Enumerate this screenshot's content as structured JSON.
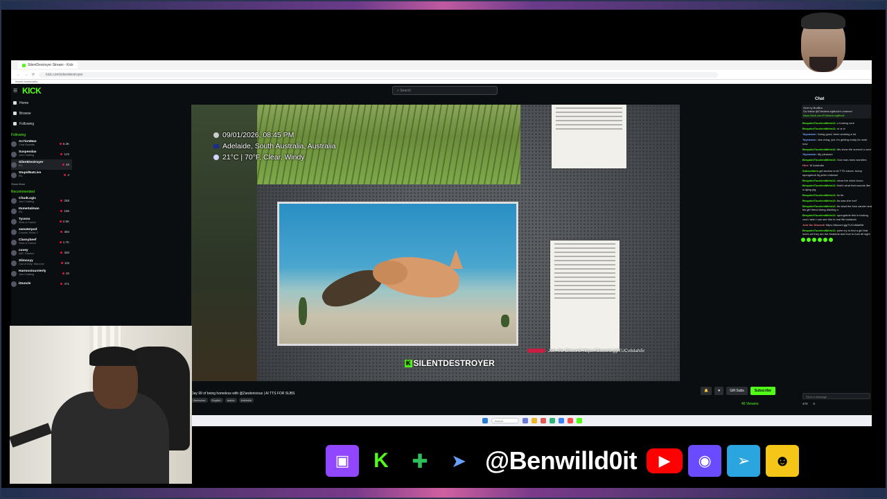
{
  "browser": {
    "tab_title": "SilentDestroyer Stream - Kick",
    "url": "kick.com/silentdestroyer",
    "bookmarks": "Import bookmarks..."
  },
  "kick": {
    "logo": "KICK",
    "search_placeholder": "Search",
    "nav": [
      "Home",
      "Browse",
      "Following"
    ],
    "following_title": "Following",
    "following": [
      {
        "name": "Ac7ionMan",
        "cat": "Chat Roulette",
        "viewers": "6.3K"
      },
      {
        "name": "Suspendas",
        "cat": "Just Chatting",
        "viewers": "123"
      },
      {
        "name": "SilentDestroyer",
        "cat": "IRL",
        "viewers": "46"
      },
      {
        "name": "StupidNatLive",
        "cat": "IRL",
        "viewers": "4"
      }
    ],
    "show_more": "Show More",
    "recommended_title": "Recommended",
    "recommended": [
      {
        "name": "ChudLogic",
        "cat": "Just Chatting",
        "viewers": "258"
      },
      {
        "name": "ItsmeSalman",
        "cat": "IRL",
        "viewers": "196"
      },
      {
        "name": "Tyceno",
        "cat": "Slots & Casino",
        "viewers": "2.5K"
      },
      {
        "name": "sweaterpxd",
        "cat": "Counter-Strike 2",
        "viewers": "383"
      },
      {
        "name": "Classybeef",
        "cat": "Slots & Casino",
        "viewers": "1.7K"
      },
      {
        "name": "cuvey",
        "cat": "ARC Raiders",
        "viewers": "300"
      },
      {
        "name": "Slimssyy",
        "cat": "Call of Duty: Warzone",
        "viewers": "115"
      },
      {
        "name": "HarmoniousVerly",
        "cat": "Just Chatting",
        "viewers": "20"
      },
      {
        "name": "iDuncle",
        "cat": "",
        "viewers": "471"
      }
    ]
  },
  "stream": {
    "overlay_datetime": "09/01/2026, 08:45 PM",
    "overlay_location": "Adelaide, South Australia, Australia",
    "overlay_weather": "21°C | 70°F, Clear, Windy",
    "brand_k": "K",
    "brand_name": "SILENTDESTROYER",
    "discord_text": "Join the Discord! https://discord.gg/TUCv8daN5r",
    "title": "Day 99 of being homeless with @Zandericious | AI TTS FOR SUBS",
    "tags": [
      "Awesome",
      "English",
      "arabic",
      "Adelaide"
    ],
    "gift_subs": "Gift Subs",
    "subscribe": "Subscribe",
    "viewers": "46 Viewers"
  },
  "chat": {
    "title": "Chat",
    "pinned_user": "Sent by BudBro",
    "pinned_text": "Go follow @ChickenLegModz's channel",
    "pinned_link": "https://kick.com/ChickenLegModz",
    "messages": [
      {
        "user": "BespokeTouchesMeIm12:",
        "text": "u fucking cunt"
      },
      {
        "user": "BespokeTouchesMeIm12:",
        "text": "oi oi oi"
      },
      {
        "user": "Taysmann:",
        "text": "Doing good, been working a lot"
      },
      {
        "user": "BespokeTouchesMeIm12:",
        "text": "",
        "kind": "plain"
      },
      {
        "user": "Taysmann:",
        "text": "cha ching, yes I'm getting ready for work now"
      },
      {
        "user": "BespokeTouchesMeIm12:",
        "text": "fits show the sunroof u cunt"
      },
      {
        "user": "Taysmann:",
        "text": "My pleasure"
      },
      {
        "user": "BespokeTouchesMeIm12:",
        "text": "God man does wonders"
      },
      {
        "user": "Hiro:",
        "text": "W Australia"
      },
      {
        "user": "Subscribers",
        "text": "get access to AI TTS voices: trump spongebob lbj peter mrbeast"
      },
      {
        "user": "BespokeTouchesMeIm12:",
        "text": "show the chick brooo"
      },
      {
        "user": "BespokeTouchesMeIm12:",
        "text": "that's what that sounds like a dying pig"
      },
      {
        "user": "BespokeTouchesMeIm12:",
        "text": "fix tts"
      },
      {
        "user": "BespokeTouchesMeIm12:",
        "text": "tts was she hot?"
      },
      {
        "user": "BespokeTouchesMeIm12:",
        "text": "tts what the fuck zander and his girl friend doing ditching u"
      },
      {
        "user": "BespokeTouchesMeIm12:",
        "text": "spongebob this is fucking cool i wish i can see this in real life hahahah"
      },
      {
        "user": "Join the Discord!",
        "text": "https://discord.gg/TUCv8daN5r"
      },
      {
        "user": "BespokeTouchesMeIm12:",
        "text": "peter try to find a girl that loves art they are the freakiest and love to fuck all night"
      }
    ],
    "send_placeholder": "Send a message",
    "points": "470",
    "count": "0"
  },
  "taskbar": {
    "search": "Search"
  },
  "socials": {
    "handle": "@Benwilld0it"
  }
}
